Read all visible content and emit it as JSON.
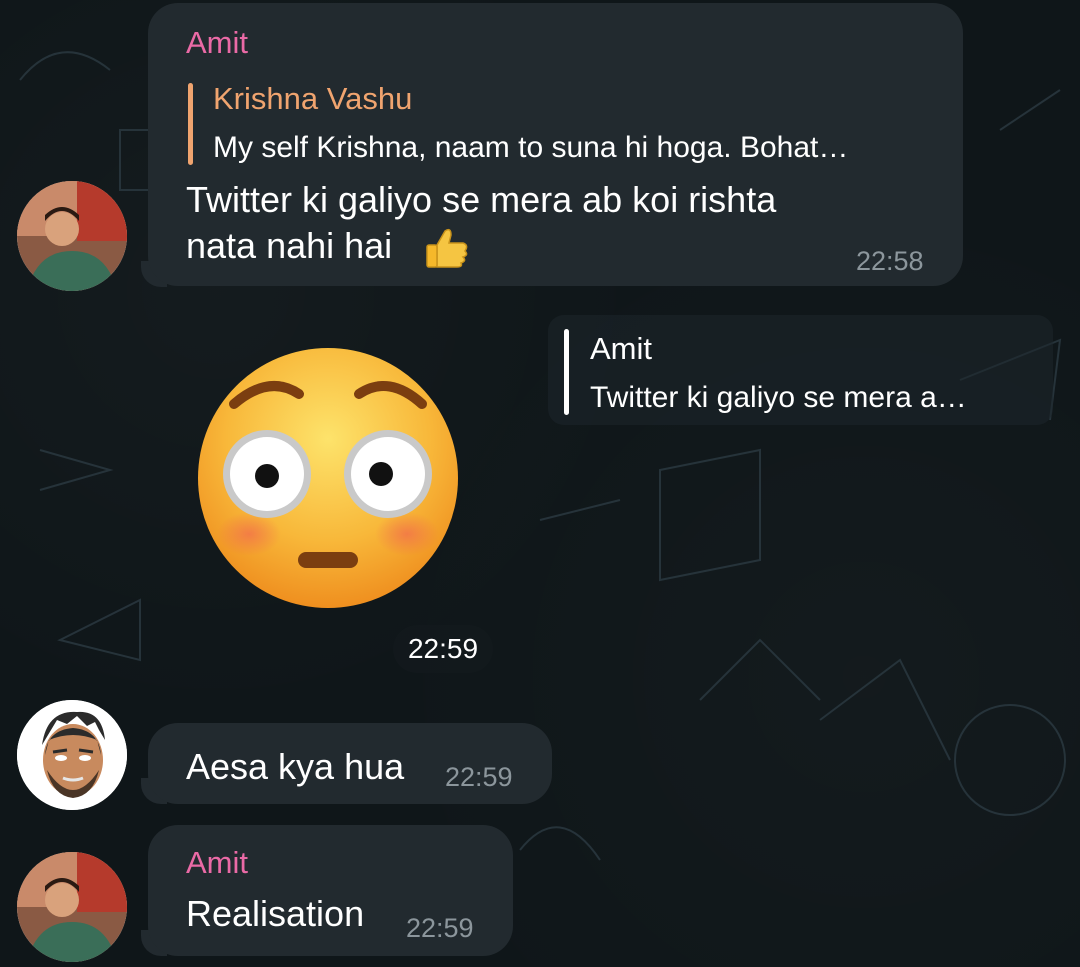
{
  "messages": [
    {
      "sender": "Amit",
      "reply_to": {
        "name": "Krishna Vashu",
        "text": "My self Krishna, naam to suna hi hoga. Bohat…"
      },
      "line1": "Twitter ki galiyo se mera ab koi rishta",
      "line2": "nata nahi hai",
      "emoji": "thumbs-up-icon",
      "time": "22:58"
    },
    {
      "reply_to": {
        "name": "Amit",
        "text": "Twitter ki galiyo se mera a…"
      },
      "sticker": "flushed-face-icon",
      "time": "22:59"
    },
    {
      "text": "Aesa kya hua",
      "time": "22:59"
    },
    {
      "sender": "Amit",
      "text": "Realisation",
      "time": "22:59"
    }
  ],
  "colors": {
    "sender_name": "#ea6aa6",
    "quote_name": "#f0a46f",
    "bubble_bg": "#222a2f",
    "timestamp": "#8c969c",
    "background": "#0f1619"
  }
}
